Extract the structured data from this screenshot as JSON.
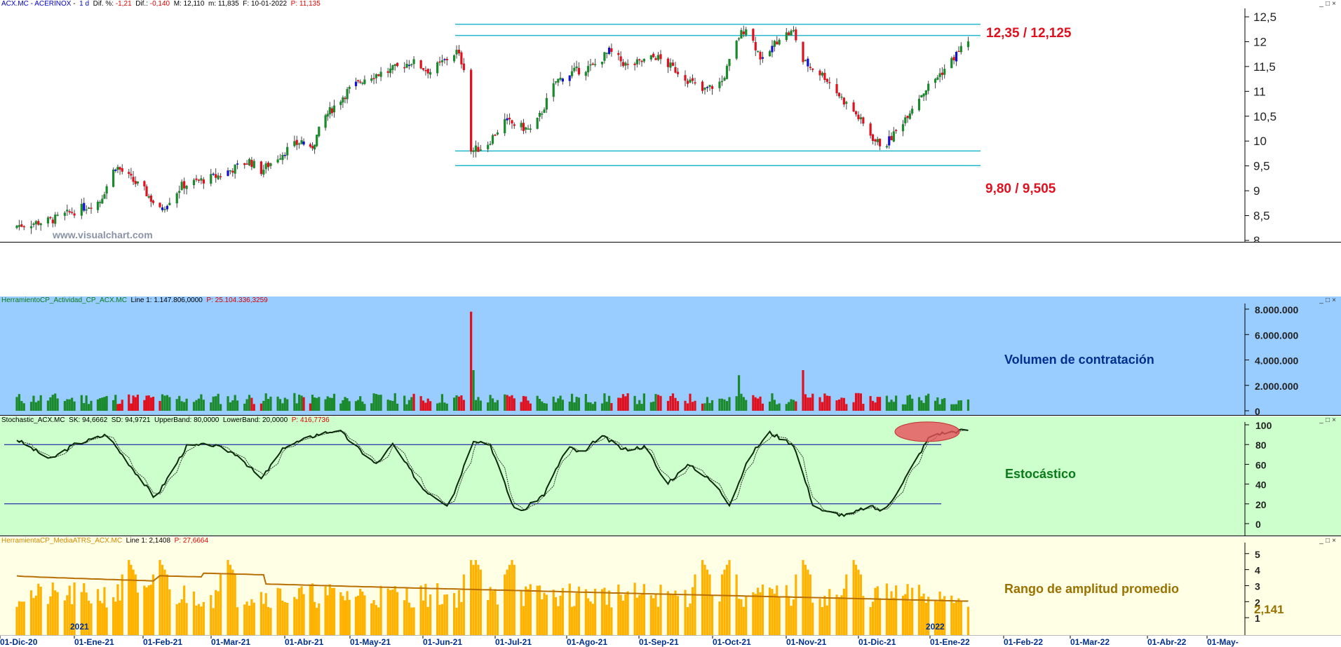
{
  "colors": {
    "up": "#1a8a2c",
    "down": "#e0101e",
    "blue_candle": "#1010d0",
    "cyan": "#22b8cc",
    "vol_bg": "#99ccff",
    "stoch_bg": "#ccffcc",
    "atr_bg": "#ffffe6",
    "atr_bar": "#ffb300",
    "atr_line": "#b86e00",
    "ellipse": "#e8505a",
    "price_label": "#e0101e",
    "annot_vol": "#002f8f",
    "annot_stoch": "#0a7a1a",
    "annot_atr": "#9a7200"
  },
  "price_panel": {
    "title": {
      "symbol": "ACX.MC - ACERINOX",
      "tf": "1 d",
      "dif_pct_label": "Dif. %:",
      "dif_pct": "-1,21",
      "dif_label": "Dif.:",
      "dif": "-0,140",
      "max_label": "M:",
      "max": "12,110",
      "min_label": "m:",
      "min": "11,835",
      "date_label": "F:",
      "date": "10-01-2022",
      "p_label": "P:",
      "p": "11,135"
    },
    "watermark": "www.visualchart.com",
    "resistance_label": "12,35 / 12,125",
    "support_label": "9,80 / 9,505"
  },
  "volume_panel": {
    "title": {
      "name": "HerramientoCP_Actividad_CP_ACX.MC",
      "line_label": "Line 1:",
      "line": "1.147.806,0000",
      "p_label": "P:",
      "p": "25.104.336,3259"
    },
    "annotation": "Volumen de contratación"
  },
  "stoch_panel": {
    "title": {
      "name": "Stochastic_ACX.MC",
      "sk_label": "SK:",
      "sk": "94,6662",
      "sd_label": "SD:",
      "sd": "94,9721",
      "ub_label": "UpperBand:",
      "ub": "80,0000",
      "lb_label": "LowerBand:",
      "lb": "20,0000",
      "p_label": "P:",
      "p": "416,7736"
    },
    "annotation": "Estocástico"
  },
  "atr_panel": {
    "title": {
      "name": "HerramientaCP_MediaATRS_ACX.MC",
      "line_label": "Line 1:",
      "line": "2,1408",
      "p_label": "P:",
      "p": "27,6664"
    },
    "annotation": "Rango de amplitud promedio",
    "last_value": "2,141",
    "year_marks": [
      "2021",
      "2022"
    ]
  },
  "x_axis": {
    "labels": [
      "01-Dic-20",
      "01-Ene-21",
      "01-Feb-21",
      "01-Mar-21",
      "01-Abr-21",
      "01-May-21",
      "01-Jun-21",
      "01-Jul-21",
      "01-Ago-21",
      "01-Sep-21",
      "01-Oct-21",
      "01-Nov-21",
      "01-Dic-21",
      "01-Ene-22",
      "01-Feb-22",
      "01-Mar-22",
      "01-Abr-22",
      "01-May-"
    ]
  },
  "chart_data": [
    {
      "type": "candlestick",
      "title": "ACX.MC - ACERINOX",
      "ylim": [
        8,
        12.5
      ],
      "y_ticks": [
        "12,5",
        "12",
        "11,5",
        "11",
        "10,5",
        "10",
        "9,5",
        "9",
        "8,5",
        "8"
      ],
      "anchors": [
        [
          "2020-12-01",
          8.3
        ],
        [
          "2020-12-15",
          8.4
        ],
        [
          "2021-01-05",
          8.8
        ],
        [
          "2021-01-12",
          9.5
        ],
        [
          "2021-01-25",
          9.0
        ],
        [
          "2021-02-01",
          8.6
        ],
        [
          "2021-02-10",
          9.1
        ],
        [
          "2021-02-25",
          9.3
        ],
        [
          "2021-03-10",
          9.6
        ],
        [
          "2021-03-15",
          9.4
        ],
        [
          "2021-03-25",
          9.8
        ],
        [
          "2021-04-01",
          10.0
        ],
        [
          "2021-04-05",
          9.8
        ],
        [
          "2021-04-12",
          10.5
        ],
        [
          "2021-04-22",
          11.0
        ],
        [
          "2021-05-01",
          11.3
        ],
        [
          "2021-05-10",
          11.4
        ],
        [
          "2021-05-20",
          11.6
        ],
        [
          "2021-05-28",
          11.4
        ],
        [
          "2021-06-08",
          11.8
        ],
        [
          "2021-06-11",
          11.5
        ],
        [
          "2021-06-14",
          9.8
        ],
        [
          "2021-06-20",
          9.9
        ],
        [
          "2021-06-28",
          10.4
        ],
        [
          "2021-07-10",
          10.2
        ],
        [
          "2021-07-20",
          11.2
        ],
        [
          "2021-07-28",
          11.4
        ],
        [
          "2021-08-05",
          11.5
        ],
        [
          "2021-08-12",
          11.8
        ],
        [
          "2021-08-20",
          11.5
        ],
        [
          "2021-09-01",
          11.7
        ],
        [
          "2021-09-10",
          11.4
        ],
        [
          "2021-09-20",
          11.0
        ],
        [
          "2021-09-28",
          11.2
        ],
        [
          "2021-10-05",
          12.1
        ],
        [
          "2021-10-08",
          12.3
        ],
        [
          "2021-10-15",
          11.6
        ],
        [
          "2021-10-22",
          12.1
        ],
        [
          "2021-10-28",
          12.2
        ],
        [
          "2021-11-01",
          11.6
        ],
        [
          "2021-11-10",
          11.3
        ],
        [
          "2021-11-18",
          10.8
        ],
        [
          "2021-11-22",
          10.6
        ],
        [
          "2021-11-28",
          10.2
        ],
        [
          "2021-12-01",
          10.0
        ],
        [
          "2021-12-05",
          9.9
        ],
        [
          "2021-12-10",
          10.2
        ],
        [
          "2021-12-20",
          10.9
        ],
        [
          "2022-01-01",
          11.5
        ],
        [
          "2022-01-10",
          12.05
        ]
      ],
      "levels": {
        "resistance": [
          12.35,
          12.125
        ],
        "support": [
          9.8,
          9.505
        ]
      }
    },
    {
      "type": "bar",
      "title": "HerramientoCP_Actividad_CP_ACX.MC",
      "ylim": [
        0,
        8000000
      ],
      "y_ticks": [
        "8.000.000",
        "6.000.000",
        "4.000.000",
        "2.000.000",
        "0"
      ],
      "baseline": 1000000,
      "spikes": [
        [
          "2021-06-14",
          7800000
        ],
        [
          "2021-06-15",
          3200000
        ],
        [
          "2021-10-05",
          2800000
        ],
        [
          "2021-11-01",
          3200000
        ]
      ]
    },
    {
      "type": "line",
      "title": "Stochastic_ACX.MC",
      "ylim": [
        0,
        100
      ],
      "y_ticks": [
        "100",
        "80",
        "60",
        "40",
        "20",
        "0"
      ],
      "bands": [
        80,
        20
      ],
      "sk_anchors": [
        [
          "2020-12-01",
          85
        ],
        [
          "2020-12-15",
          65
        ],
        [
          "2020-12-25",
          80
        ],
        [
          "2021-01-08",
          90
        ],
        [
          "2021-01-20",
          55
        ],
        [
          "2021-01-30",
          25
        ],
        [
          "2021-02-12",
          78
        ],
        [
          "2021-02-22",
          80
        ],
        [
          "2021-03-05",
          70
        ],
        [
          "2021-03-15",
          45
        ],
        [
          "2021-03-25",
          78
        ],
        [
          "2021-04-08",
          90
        ],
        [
          "2021-04-18",
          95
        ],
        [
          "2021-04-25",
          80
        ],
        [
          "2021-05-05",
          60
        ],
        [
          "2021-05-12",
          80
        ],
        [
          "2021-05-25",
          35
        ],
        [
          "2021-06-05",
          18
        ],
        [
          "2021-06-15",
          85
        ],
        [
          "2021-06-22",
          80
        ],
        [
          "2021-07-01",
          20
        ],
        [
          "2021-07-05",
          12
        ],
        [
          "2021-07-15",
          30
        ],
        [
          "2021-07-25",
          78
        ],
        [
          "2021-08-01",
          70
        ],
        [
          "2021-08-08",
          90
        ],
        [
          "2021-08-18",
          75
        ],
        [
          "2021-08-28",
          78
        ],
        [
          "2021-09-05",
          40
        ],
        [
          "2021-09-15",
          60
        ],
        [
          "2021-09-25",
          40
        ],
        [
          "2021-10-01",
          20
        ],
        [
          "2021-10-10",
          70
        ],
        [
          "2021-10-18",
          92
        ],
        [
          "2021-10-28",
          80
        ],
        [
          "2021-11-05",
          20
        ],
        [
          "2021-11-10",
          12
        ],
        [
          "2021-11-20",
          8
        ],
        [
          "2021-11-28",
          18
        ],
        [
          "2021-12-05",
          12
        ],
        [
          "2021-12-15",
          50
        ],
        [
          "2021-12-25",
          90
        ],
        [
          "2022-01-10",
          95
        ]
      ]
    },
    {
      "type": "bar",
      "title": "HerramientaCP_MediaATRS_ACX.MC",
      "ylim": [
        0,
        5
      ],
      "y_ticks": [
        "5",
        "4",
        "3",
        "2",
        "1"
      ],
      "ma_start": 3.8,
      "ma_end": 2.14,
      "last": 2.141
    }
  ]
}
